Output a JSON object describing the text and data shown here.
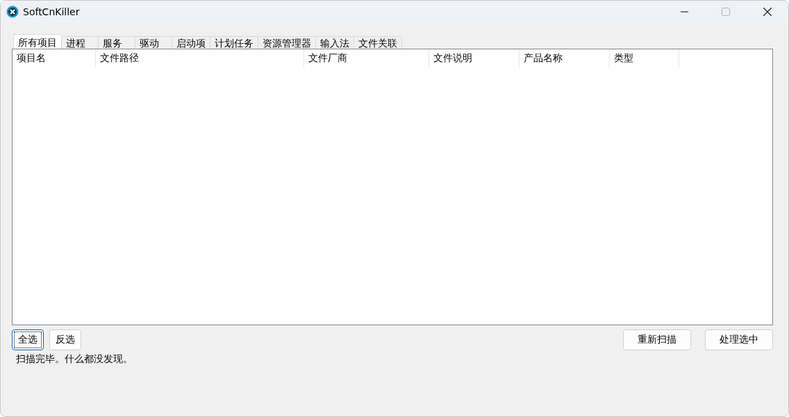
{
  "window": {
    "title": "SoftCnKiller"
  },
  "tabs": [
    {
      "label": "所有项目",
      "selected": true
    },
    {
      "label": "进程",
      "selected": false
    },
    {
      "label": "服务",
      "selected": false
    },
    {
      "label": "驱动",
      "selected": false
    },
    {
      "label": "启动项",
      "selected": false
    },
    {
      "label": "计划任务",
      "selected": false
    },
    {
      "label": "资源管理器",
      "selected": false
    },
    {
      "label": "输入法",
      "selected": false
    },
    {
      "label": "文件关联",
      "selected": false
    }
  ],
  "table": {
    "columns": [
      "项目名",
      "文件路径",
      "文件厂商",
      "文件说明",
      "产品名称",
      "类型"
    ]
  },
  "left_buttons": [
    {
      "label": "全选",
      "focused": true
    },
    {
      "label": "反选",
      "focused": false
    }
  ],
  "right_buttons": [
    "重新扫描",
    "处理选中"
  ],
  "status_text": "扫描完毕。什么都没发现。"
}
